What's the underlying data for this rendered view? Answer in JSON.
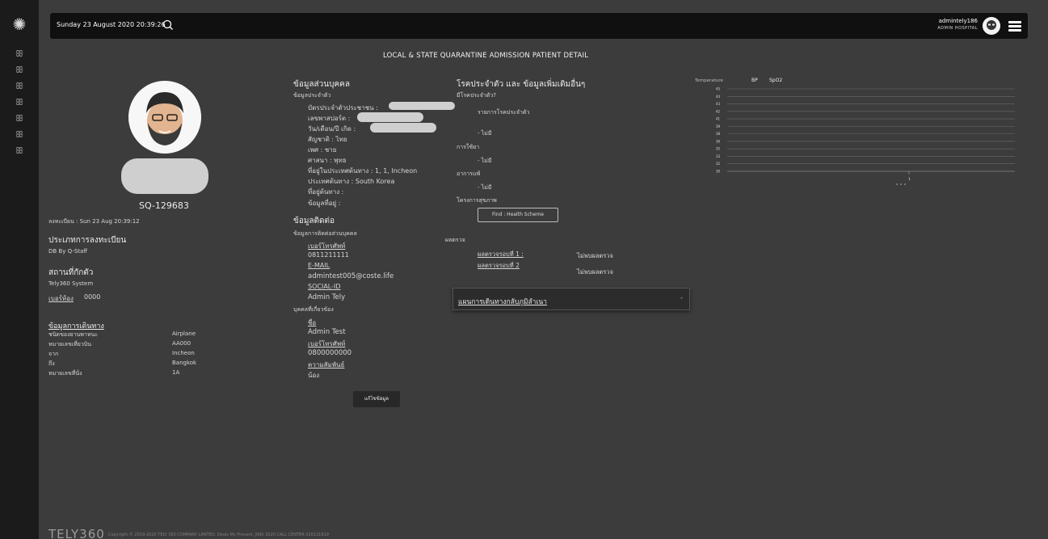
{
  "header": {
    "date": "Sunday 23 August 2020 20:39:26",
    "username": "admintely186",
    "hospital": "ADMIN HOSPITAL"
  },
  "page_title": "LOCAL & STATE QUARANTINE ADMISSION PATIENT DETAIL",
  "profile": {
    "patient_id": "SQ-129683",
    "registered": "ลงทะเบียน : Sun 23 Aug 20:39:12",
    "reg_type_label": "ประเภทการลงทะเบียน",
    "reg_type_value": "DB By Q-Staff",
    "quarantine_label": "สถานที่กักตัว",
    "quarantine_value": "Tely360 System",
    "room_label": "เบอร์ห้อง",
    "room_value": "0000"
  },
  "travel": {
    "title": "ข้อมูลการเดินทาง",
    "rows": [
      {
        "label": "ชนิดของยานพาหนะ",
        "value": "Airplane"
      },
      {
        "label": "หมายเลขเที่ยวบิน",
        "value": "AA000"
      },
      {
        "label": "จาก",
        "value": "Incheon"
      },
      {
        "label": "ถึง",
        "value": "Bangkok"
      },
      {
        "label": "หมายเลขที่นั่ง",
        "value": "1A"
      }
    ]
  },
  "personal": {
    "title": "ข้อมูลส่วนบุคคล",
    "subtitle": "ข้อมูลประจำตัว",
    "id_card": "บัตรประจำตัวประชาชน :",
    "passport": "เลขพาสปอร์ต :",
    "dob": "วัน/เดือน/ปี เกิด :",
    "nationality": "สัญชาติ : ไทย",
    "gender": "เพศ : ชาย",
    "religion": "ศาสนา : พุทธ",
    "origin_address": "ที่อยู่ในประเทศต้นทาง : 1, 1, Incheon",
    "origin_country": "ประเทศต้นทาง : South Korea",
    "dest_address": "ที่อยู่ต้นทาง :",
    "current_address": "ข้อมูลที่อยู่ :"
  },
  "contact": {
    "title": "ข้อมูลติดต่อ",
    "subtitle": "ข้อมูลการติดต่อส่วนบุคคล",
    "phone_label": "เบอร์โทรศัพท์",
    "phone": "0811211111",
    "email_label": "E-MAIL",
    "email": "admintest005@coste.life",
    "social_label": "SOCIAL-ID",
    "social": "Admin Tely",
    "related_title": "บุคคลที่เกี่ยวข้อง",
    "name_label": "ชื่อ",
    "name": "Admin Test",
    "rel_phone_label": "เบอร์โทรศัพท์",
    "rel_phone": "0800000000",
    "relation_label": "ความสัมพันธ์",
    "relation": "น้อง",
    "edit_button": "แก้ไขข้อมูล"
  },
  "medical": {
    "title": "โรคประจำตัว และ ข้อมูลเพิ่มเติมอื่นๆ",
    "has_disease": "มีโรคประจำตัว?",
    "disease_list": "รายการโรคประจำตัว",
    "disease_none": "- ไม่มี",
    "drug_label": "การใช้ยา",
    "drug_none": "- ไม่มี",
    "allergy_label": "อาการแพ้",
    "allergy_none": "- ไม่มี",
    "health_label": "โครงการสุขภาพ",
    "find_button": "Find : Health Scheme",
    "test_title": "ผลตรวจ",
    "test1_label": "ผลตรวจรอบที่ 1 :",
    "test1_value": "ไม่พบผลตรวจ",
    "test2_label": "ผลตรวจรอบที่ 2",
    "test2_value": "ไม่พบผลตรวจ",
    "travel_plan": "แผนการเดินทางกลับภูมิลำเนา",
    "travel_plan_caret": "-"
  },
  "chart_data": {
    "type": "line",
    "series": [
      {
        "name": "Temperature",
        "values": []
      },
      {
        "name": "BP",
        "values": []
      },
      {
        "name": "SpO2",
        "values": []
      }
    ],
    "y_ticks": [
      "45",
      "44",
      "43",
      "42",
      "41",
      "39",
      "38",
      "36",
      "35",
      "33",
      "32",
      "30"
    ],
    "x_ticks": [
      "1"
    ],
    "grid": true,
    "legend_position": "top-left"
  },
  "footer": {
    "brand": "TELY360",
    "copyright": "Copyright © 2019-2020 TELY 360 COMPANY LIMITED. Deals My Prevent. JIKKI 2020 CALL CENTER 020131819"
  }
}
